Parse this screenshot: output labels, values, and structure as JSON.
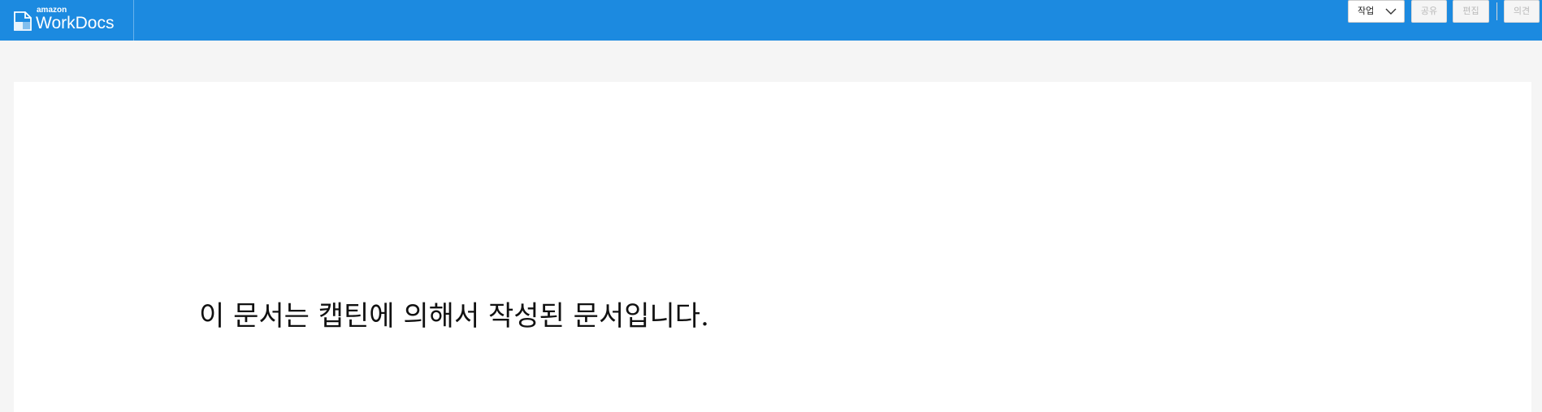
{
  "header": {
    "brand_small": "amazon",
    "brand_name": "WorkDocs",
    "logo_icon": "document-icon",
    "bar_color": "#1c8ae0"
  },
  "toolbar": {
    "action_label": "작업",
    "action_icon": "chevron-down-icon",
    "share_label": "공유",
    "edit_label": "편집",
    "comment_label": "의견"
  },
  "document": {
    "text": "이 문서는 캡틴에 의해서 작성된 문서입니다."
  }
}
